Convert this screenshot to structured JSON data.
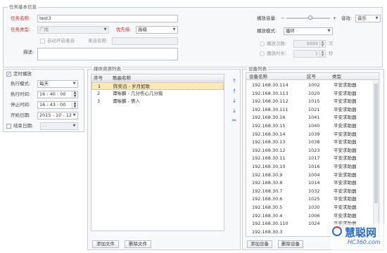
{
  "task_info": {
    "section_title": "任务基本信息",
    "name_label": "任务名称:",
    "name_value": "test3",
    "type_label": "任务类型:",
    "type_value": "广播",
    "priority_label": "优先级:",
    "priority_value": "高级",
    "auto_record_label": "自动开启录音",
    "record_name_label": "录音名称:",
    "description_label": "描述:",
    "volume_label": "播放音量:",
    "volume_minus": "−",
    "volume_plus": "+",
    "volume_level": 0.55,
    "sound_label": "音效:",
    "sound_value": "音乐",
    "play_mode_label": "播放模式:",
    "play_mode_value": "循环",
    "play_count_label": "播放次数:",
    "play_count_value": "9999",
    "play_count_unit": "次",
    "play_time_label": "播放时长:",
    "play_time_value": "1",
    "play_time_unit": "秒"
  },
  "schedule": {
    "timer_label": "定时播放",
    "exec_mode_label": "执行模式:",
    "exec_mode_value": "每天",
    "exec_time_label": "执行时间:",
    "exec_time_value": "16 : 40 : 00",
    "stop_time_label": "停止时间:",
    "stop_time_value": "16 : 43 : 00",
    "start_date_label": "开始日期:",
    "start_date_value": "2015 - 10 - 12",
    "end_date_label": "结束日期:",
    "end_date_value": "-  -"
  },
  "media": {
    "section_title": "媒体资源列表",
    "col_index": "序号",
    "col_name": "歌曲名称",
    "rows": [
      {
        "index": "1",
        "name": "陈奕迅 - 岁月如歌"
      },
      {
        "index": "2",
        "name": "谭咏麟 - 几分伤心几分痴"
      },
      {
        "index": "3",
        "name": "谭咏麟 - 情人"
      }
    ],
    "add_button": "添加文件",
    "delete_button": "删除文件"
  },
  "devices": {
    "section_title": "设备列表",
    "col_name": "设备名称",
    "col_zone": "区号",
    "col_type": "类型",
    "rows": [
      {
        "name": "192.168.30.114",
        "zone": "1002",
        "type": "平安求助器"
      },
      {
        "name": "192.168.30.113",
        "zone": "1020",
        "type": "平安求助器"
      },
      {
        "name": "192.168.30.112",
        "zone": "1015",
        "type": "平安求助器"
      },
      {
        "name": "192.168.30.111",
        "zone": "1021",
        "type": "平安求助器"
      },
      {
        "name": "192.168.30.16",
        "zone": "1041",
        "type": "平安求助器"
      },
      {
        "name": "192.168.30.15",
        "zone": "1040",
        "type": "平安求助器"
      },
      {
        "name": "192.168.30.14",
        "zone": "1039",
        "type": "平安求助器"
      },
      {
        "name": "192.168.30.13",
        "zone": "1038",
        "type": "平安求助器"
      },
      {
        "name": "192.168.30.12",
        "zone": "1023",
        "type": "平安求助器"
      },
      {
        "name": "192.168.30.11",
        "zone": "1017",
        "type": "平安求助器"
      },
      {
        "name": "192.168.30.10",
        "zone": "1016",
        "type": "平安求助器"
      },
      {
        "name": "192.168.30.9",
        "zone": "1004",
        "type": "平安求助器"
      },
      {
        "name": "192.168.30.8",
        "zone": "1014",
        "type": "平安求助器"
      },
      {
        "name": "192.168.30.7",
        "zone": "1032",
        "type": "平安求助器"
      },
      {
        "name": "192.168.30.6",
        "zone": "1025",
        "type": "平安求助器"
      },
      {
        "name": "192.168.30.5",
        "zone": "1030",
        "type": "平安求助器"
      },
      {
        "name": "192.168.30.4",
        "zone": "1006",
        "type": "平安求助器"
      },
      {
        "name": "192.168.30.110",
        "zone": "1024",
        "type": "平安求助器"
      },
      {
        "name": "192.168.30.3",
        "zone": "",
        "type": ""
      }
    ],
    "add_button": "添加设备",
    "delete_button": "删除设备"
  },
  "watermark": {
    "text": "慧聪网",
    "url": "HC360.com"
  }
}
